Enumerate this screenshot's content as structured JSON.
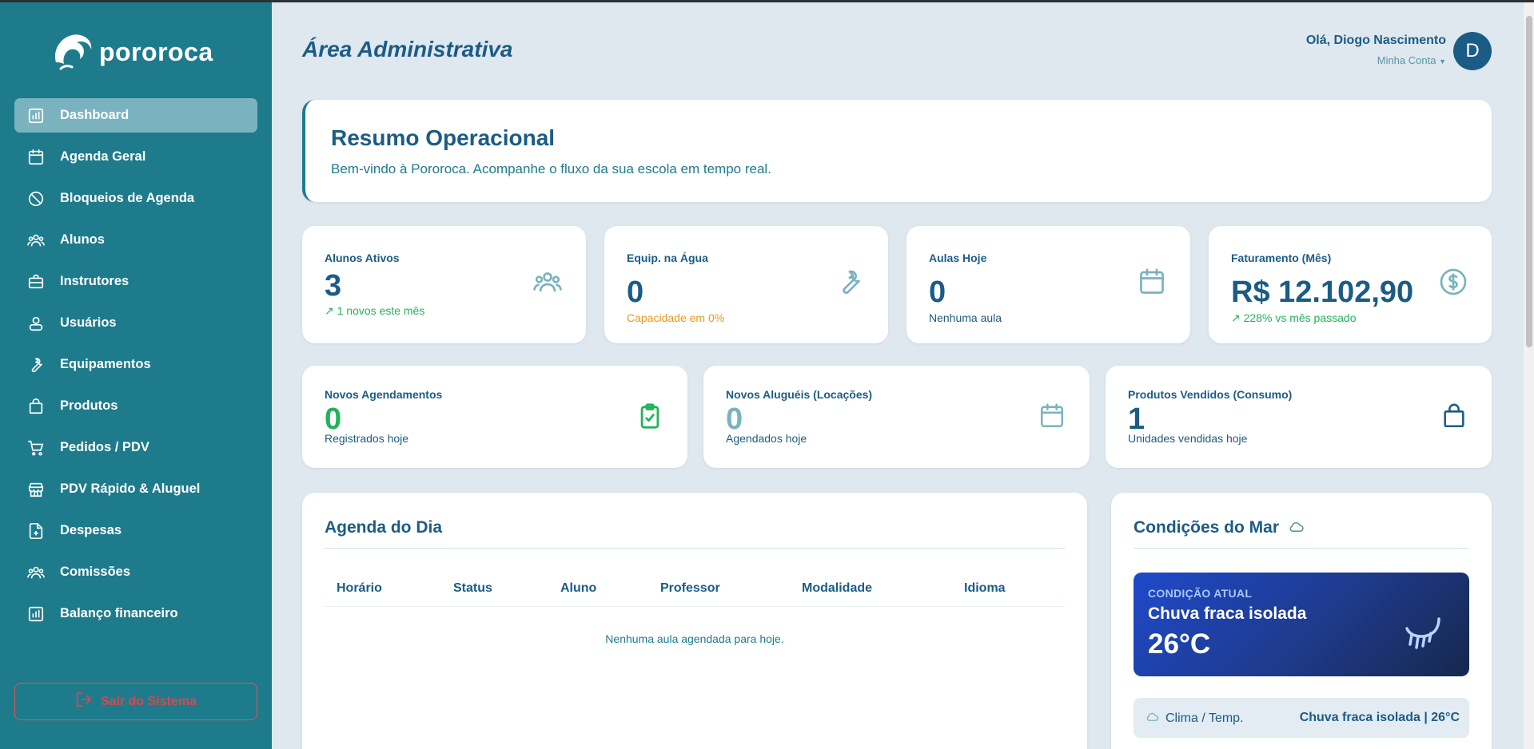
{
  "app": {
    "logo_text": "pororoca"
  },
  "sidebar": {
    "items": [
      {
        "label": "Dashboard",
        "icon": "chart-icon",
        "active": true
      },
      {
        "label": "Agenda Geral",
        "icon": "calendar-icon"
      },
      {
        "label": "Bloqueios de Agenda",
        "icon": "ban-icon"
      },
      {
        "label": "Alunos",
        "icon": "users-icon"
      },
      {
        "label": "Instrutores",
        "icon": "briefcase-icon"
      },
      {
        "label": "Usuários",
        "icon": "user-icon"
      },
      {
        "label": "Equipamentos",
        "icon": "wrench-icon"
      },
      {
        "label": "Produtos",
        "icon": "bag-icon"
      },
      {
        "label": "Pedidos / PDV",
        "icon": "cart-icon"
      },
      {
        "label": "PDV Rápido & Aluguel",
        "icon": "store-icon"
      },
      {
        "label": "Despesas",
        "icon": "file-plus-icon"
      },
      {
        "label": "Comissões",
        "icon": "users-icon"
      },
      {
        "label": "Balanço financeiro",
        "icon": "chart-icon"
      }
    ],
    "logout_label": "Sair do Sistema"
  },
  "header": {
    "title": "Área Administrativa",
    "greeting": "Olá, Diogo Nascimento",
    "account_label": "Minha Conta",
    "avatar_initial": "D"
  },
  "hero": {
    "title": "Resumo Operacional",
    "subtitle": "Bem-vindo à Pororoca. Acompanhe o fluxo da sua escola em tempo real."
  },
  "stats_top": [
    {
      "label": "Alunos Ativos",
      "value": "3",
      "sub": "↗ 1 novos este mês",
      "sub_color": "#22b35a",
      "value_color": "#1b5c86",
      "icon": "users-icon"
    },
    {
      "label": "Equip. na Água",
      "value": "0",
      "sub": "Capacidade em 0%",
      "sub_color": "#e69a1a",
      "value_color": "#1b5c86",
      "icon": "wrench-icon"
    },
    {
      "label": "Aulas Hoje",
      "value": "0",
      "sub": "Nenhuma aula",
      "sub_color": "#1e5c7e",
      "value_color": "#1b5c86",
      "icon": "calendar-icon"
    },
    {
      "label": "Faturamento (Mês)",
      "value": "R$ 12.102,90",
      "sub": "↗ 228% vs mês passado",
      "sub_color": "#22b35a",
      "value_color": "#1b5c86",
      "icon": "dollar-icon"
    }
  ],
  "stats_bottom": [
    {
      "label": "Novos Agendamentos",
      "value": "0",
      "sub": "Registrados hoje",
      "value_color": "#22b35a",
      "icon": "clipboard-check-icon"
    },
    {
      "label": "Novos Aluguéis (Locações)",
      "value": "0",
      "sub": "Agendados hoje",
      "value_color": "#7ab3bf",
      "icon": "calendar-icon"
    },
    {
      "label": "Produtos Vendidos (Consumo)",
      "value": "1",
      "sub": "Unidades vendidas hoje",
      "value_color": "#1b5c86",
      "icon": "bag-icon"
    }
  ],
  "agenda": {
    "title": "Agenda do Dia",
    "columns": [
      "Horário",
      "Status",
      "Aluno",
      "Professor",
      "Modalidade",
      "Idioma"
    ],
    "empty": "Nenhuma aula agendada para hoje."
  },
  "sea": {
    "title": "Condições do Mar",
    "condition_key": "CONDIÇÃO ATUAL",
    "condition": "Chuva fraca isolada",
    "temperature": "26°C",
    "climate_label": "Clima / Temp.",
    "climate_value": "Chuva fraca isolada | 26°C"
  }
}
